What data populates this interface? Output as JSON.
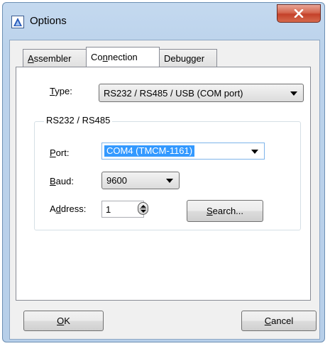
{
  "window": {
    "title": "Options"
  },
  "tabs": [
    {
      "label": "Assembler",
      "mnemonic": "A",
      "rest": "ssembler"
    },
    {
      "label": "Connection",
      "pre": "Co",
      "mnemonic": "n",
      "rest": "nection"
    },
    {
      "label": "Debugger"
    }
  ],
  "connection": {
    "type_label_mn": "T",
    "type_label_rest": "ype:",
    "type_value": "RS232 / RS485 / USB (COM port)",
    "group_title": "RS232 / RS485",
    "port_label_mn": "P",
    "port_label_rest": "ort:",
    "port_value": "COM4  (TMCM-1161)",
    "baud_label_mn": "B",
    "baud_label_rest": "aud:",
    "baud_value": "9600",
    "address_label_pre": "A",
    "address_label_mn": "d",
    "address_label_rest": "dress:",
    "address_value": "1",
    "search_mn": "S",
    "search_rest": "earch..."
  },
  "buttons": {
    "ok_mn": "O",
    "ok_rest": "K",
    "cancel_mn": "C",
    "cancel_rest": "ancel"
  },
  "colors": {
    "title_gradient": "#bcd3ec",
    "close_red": "#c4412a",
    "selection": "#3399ff"
  },
  "icons": {
    "app": "triangle-app-icon",
    "close": "close-x-icon"
  }
}
